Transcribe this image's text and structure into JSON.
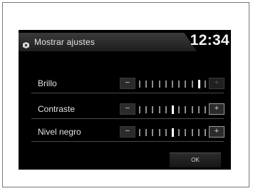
{
  "header": {
    "title": "Mostrar ajustes",
    "time": "12:34",
    "icon": "display-settings-icon"
  },
  "settings": [
    {
      "label": "Brillo",
      "level": 0.9,
      "minus": "−",
      "plus": "+"
    },
    {
      "label": "Contraste",
      "level": 0.5,
      "minus": "−",
      "plus": "+"
    },
    {
      "label": "Nivel negro",
      "level": 0.5,
      "minus": "−",
      "plus": "+"
    }
  ],
  "ok_label": "OK"
}
